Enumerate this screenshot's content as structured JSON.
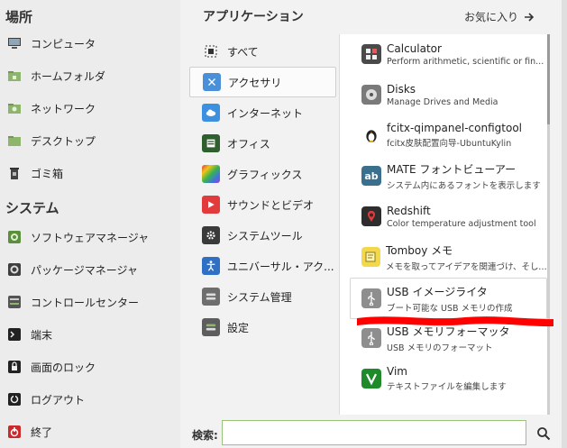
{
  "left": {
    "places_title": "場所",
    "places": [
      {
        "label": "コンピュータ",
        "icon": "computer-icon"
      },
      {
        "label": "ホームフォルダ",
        "icon": "home-folder-icon"
      },
      {
        "label": "ネットワーク",
        "icon": "network-folder-icon"
      },
      {
        "label": "デスクトップ",
        "icon": "desktop-folder-icon"
      },
      {
        "label": "ゴミ箱",
        "icon": "trash-icon"
      }
    ],
    "system_title": "システム",
    "system": [
      {
        "label": "ソフトウェアマネージャ",
        "icon": "software-manager-icon"
      },
      {
        "label": "パッケージマネージャ",
        "icon": "package-manager-icon"
      },
      {
        "label": "コントロールセンター",
        "icon": "control-center-icon"
      },
      {
        "label": "端末",
        "icon": "terminal-icon"
      },
      {
        "label": "画面のロック",
        "icon": "lock-icon"
      },
      {
        "label": "ログアウト",
        "icon": "logout-icon"
      },
      {
        "label": "終了",
        "icon": "power-icon"
      }
    ]
  },
  "header": {
    "title": "アプリケーション",
    "favorites": "お気に入り"
  },
  "categories": [
    {
      "label": "すべて",
      "icon": "all-grid-icon"
    },
    {
      "label": "アクセサリ",
      "icon": "accessories-icon"
    },
    {
      "label": "インターネット",
      "icon": "internet-cloud-icon"
    },
    {
      "label": "オフィス",
      "icon": "office-icon"
    },
    {
      "label": "グラフィックス",
      "icon": "graphics-icon"
    },
    {
      "label": "サウンドとビデオ",
      "icon": "sound-video-icon"
    },
    {
      "label": "システムツール",
      "icon": "system-tools-icon"
    },
    {
      "label": "ユニバーサル・アク...",
      "icon": "universal-access-icon"
    },
    {
      "label": "システム管理",
      "icon": "administration-icon"
    },
    {
      "label": "設定",
      "icon": "preferences-icon"
    }
  ],
  "apps": [
    {
      "name": "Calculator",
      "desc": "Perform arithmetic, scientific or fin...",
      "icon": "calculator-icon",
      "color": "#4a4a4a"
    },
    {
      "name": "Disks",
      "desc": "Manage Drives and Media",
      "icon": "disks-icon",
      "color": "#7a7a7a"
    },
    {
      "name": "fcitx-qimpanel-configtool",
      "desc": "fcitx皮肤配置向导-UbuntuKylin",
      "icon": "tux-penguin-icon",
      "color": "#ffffff"
    },
    {
      "name": "MATE フォントビューアー",
      "desc": "システム内にあるフォントを表示します",
      "icon": "font-viewer-icon",
      "color": "#3b6f8e"
    },
    {
      "name": "Redshift",
      "desc": "Color temperature adjustment tool",
      "icon": "redshift-icon",
      "color": "#2d2d2d"
    },
    {
      "name": "Tomboy メモ",
      "desc": "メモを取ってアイデアを関連づけ、そして...",
      "icon": "tomboy-note-icon",
      "color": "#f2d84a"
    },
    {
      "name": "USB イメージライタ",
      "desc": "ブート可能な USB メモリの作成",
      "icon": "usb-icon",
      "color": "#8e8e8e"
    },
    {
      "name": "USB メモリフォーマッタ",
      "desc": "USB メモリのフォーマット",
      "icon": "usb-icon",
      "color": "#8e8e8e"
    },
    {
      "name": "Vim",
      "desc": "テキストファイルを編集します",
      "icon": "vim-icon",
      "color": "#1f8a2a"
    }
  ],
  "search": {
    "label": "検索:",
    "value": ""
  },
  "colors": {
    "accent_green": "#9bc27a",
    "annotation_red": "#ff0000"
  }
}
